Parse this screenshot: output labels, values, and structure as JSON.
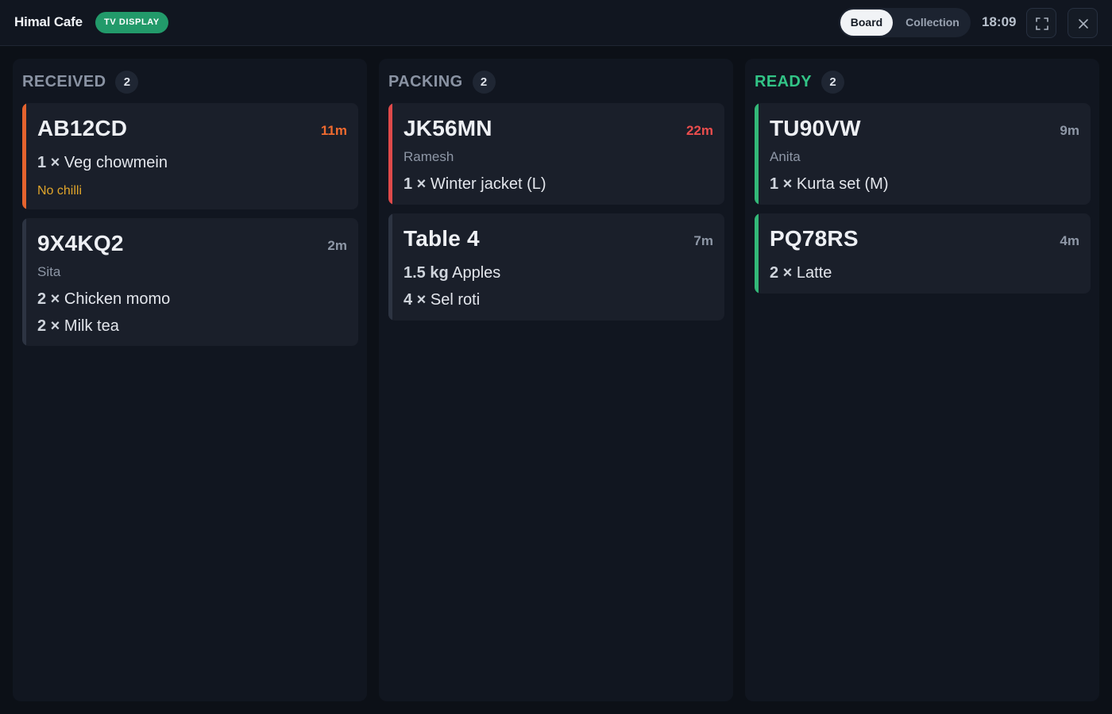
{
  "header": {
    "title": "Himal Cafe",
    "badge": "TV DISPLAY",
    "view_tabs": {
      "board": "Board",
      "collection": "Collection",
      "active": "Board"
    },
    "clock": "18:09",
    "fullscreen_icon": "fullscreen-icon",
    "close_icon": "close-icon"
  },
  "columns": {
    "received": {
      "title": "RECEIVED",
      "count": "2",
      "orders": [
        {
          "code": "AB12CD",
          "age": "11m",
          "accent": "#e4632e",
          "items": [
            {
              "qty": "1 ×",
              "name": "Veg chowmein"
            }
          ],
          "note": "No chilli"
        },
        {
          "code": "9X4KQ2",
          "age": "2m",
          "customer": "Sita",
          "items": [
            {
              "qty": "2 ×",
              "name": "Chicken momo"
            },
            {
              "qty": "2 ×",
              "name": "Milk tea"
            }
          ]
        }
      ]
    },
    "packing": {
      "title": "PACKING",
      "count": "2",
      "orders": [
        {
          "code": "JK56MN",
          "age": "22m",
          "accent": "#df4a4a",
          "customer": "Ramesh",
          "items": [
            {
              "qty": "1 ×",
              "name": "Winter jacket (L)"
            }
          ]
        },
        {
          "code": "Table 4",
          "age": "7m",
          "items": [
            {
              "qty": "1.5 kg",
              "name": "Apples"
            },
            {
              "qty": "4 ×",
              "name": "Sel roti"
            }
          ]
        }
      ]
    },
    "ready": {
      "title": "READY",
      "count": "2",
      "accent": "#32c486",
      "orders": [
        {
          "code": "TU90VW",
          "age": "9m",
          "customer": "Anita",
          "items": [
            {
              "qty": "1 ×",
              "name": "Kurta set (M)"
            }
          ]
        },
        {
          "code": "PQ78RS",
          "age": "4m",
          "items": [
            {
              "qty": "2 ×",
              "name": "Latte"
            }
          ]
        }
      ]
    }
  }
}
